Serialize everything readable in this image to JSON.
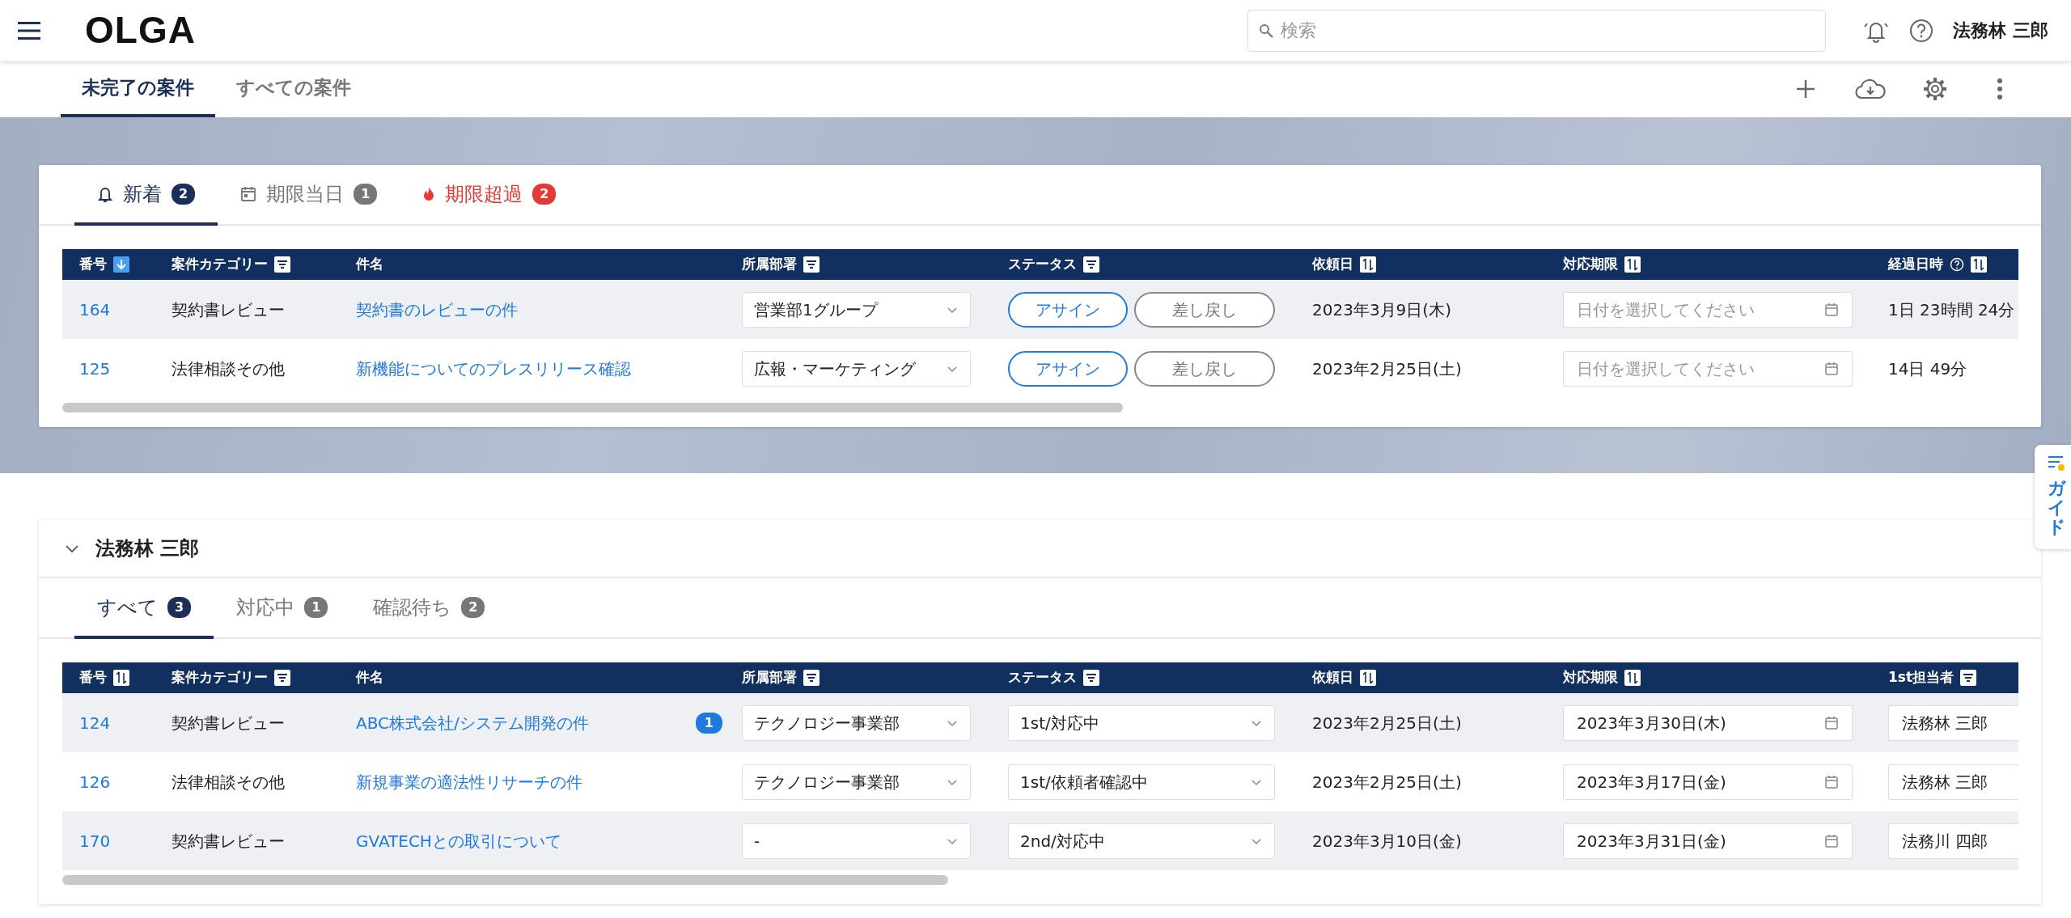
{
  "app": {
    "logo": "OLGA",
    "search": {
      "placeholder": "検索"
    },
    "user": "法務林 三郎"
  },
  "page_tabs": [
    {
      "label": "未完了の案件",
      "selected": true
    },
    {
      "label": "すべての案件",
      "selected": false
    }
  ],
  "new_cases": {
    "tabs": [
      {
        "kind": "new",
        "label": "新着",
        "count": "2",
        "selected": true
      },
      {
        "kind": "today",
        "label": "期限当日",
        "count": "1",
        "selected": false
      },
      {
        "kind": "overdue",
        "label": "期限超過",
        "count": "2",
        "selected": false
      }
    ],
    "table": {
      "columns": [
        {
          "label": "番号",
          "kind": "sort",
          "sorted": true
        },
        {
          "label": "案件カテゴリー",
          "kind": "filter"
        },
        {
          "label": "件名",
          "kind": "plain"
        },
        {
          "label": "所属部署",
          "kind": "filter"
        },
        {
          "label": "ステータス",
          "kind": "filter"
        },
        {
          "label": "依頼日",
          "kind": "sort",
          "sorted": false
        },
        {
          "label": "対応期限",
          "kind": "sort",
          "sorted": false
        },
        {
          "label": "経過日時",
          "kind": "help_sort",
          "sorted": false
        }
      ],
      "rows": [
        {
          "number": "164",
          "category": "契約書レビュー",
          "title": "契約書のレビューの件",
          "department": "営業部1グループ",
          "actions": [
            "アサイン",
            "差し戻し"
          ],
          "requested": "2023年3月9日(木)",
          "deadline": {
            "placeholder": "日付を選択してください"
          },
          "elapsed": "1日 23時間 24分"
        },
        {
          "number": "125",
          "category": "法律相談その他",
          "title": "新機能についてのプレスリリース確認",
          "department": "広報・マーケティング",
          "actions": [
            "アサイン",
            "差し戻し"
          ],
          "requested": "2023年2月25日(土)",
          "deadline": {
            "placeholder": "日付を選択してください"
          },
          "elapsed": "14日 49分"
        }
      ]
    }
  },
  "assignee_section": {
    "name": "法務林 三郎",
    "expanded": true,
    "tabs": [
      {
        "label": "すべて",
        "count": "3",
        "selected": true
      },
      {
        "label": "対応中",
        "count": "1",
        "selected": false
      },
      {
        "label": "確認待ち",
        "count": "2",
        "selected": false
      }
    ],
    "table": {
      "columns": [
        {
          "label": "番号",
          "kind": "sort",
          "sorted": false
        },
        {
          "label": "案件カテゴリー",
          "kind": "filter"
        },
        {
          "label": "件名",
          "kind": "plain"
        },
        {
          "label": "所属部署",
          "kind": "filter"
        },
        {
          "label": "ステータス",
          "kind": "filter"
        },
        {
          "label": "依頼日",
          "kind": "sort",
          "sorted": false
        },
        {
          "label": "対応期限",
          "kind": "sort",
          "sorted": false
        },
        {
          "label": "1st担当者",
          "kind": "filter"
        }
      ],
      "rows": [
        {
          "number": "124",
          "category": "契約書レビュー",
          "title": "ABC株式会社/システム開発の件",
          "comments": "1",
          "department": "テクノロジー事業部",
          "status": "1st/対応中",
          "requested": "2023年2月25日(土)",
          "deadline": {
            "value": "2023年3月30日(木)"
          },
          "assignee": "法務林 三郎"
        },
        {
          "number": "126",
          "category": "法律相談その他",
          "title": "新規事業の適法性リサーチの件",
          "department": "テクノロジー事業部",
          "status": "1st/依頼者確認中",
          "requested": "2023年2月25日(土)",
          "deadline": {
            "value": "2023年3月17日(金)"
          },
          "assignee": "法務林 三郎"
        },
        {
          "number": "170",
          "category": "契約書レビュー",
          "title": "GVATECHとの取引について",
          "department": "-",
          "status": "2nd/対応中",
          "requested": "2023年3月10日(金)",
          "deadline": {
            "value": "2023年3月31日(金)"
          },
          "assignee": "法務川 四郎"
        }
      ]
    }
  },
  "guide": {
    "label": "ガイド"
  }
}
